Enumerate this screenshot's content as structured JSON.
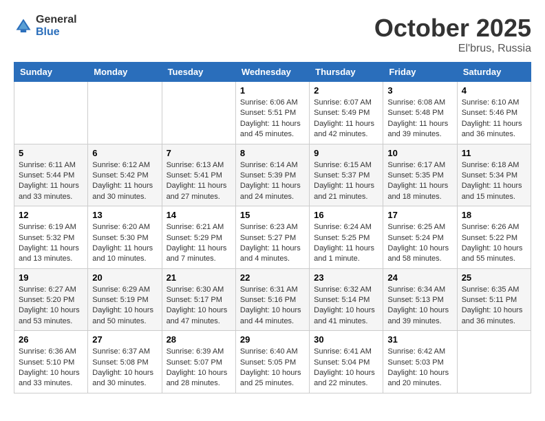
{
  "header": {
    "logo": {
      "general": "General",
      "blue": "Blue",
      "tagline": ""
    },
    "title": "October 2025",
    "location": "El'brus, Russia"
  },
  "weekdays": [
    "Sunday",
    "Monday",
    "Tuesday",
    "Wednesday",
    "Thursday",
    "Friday",
    "Saturday"
  ],
  "weeks": [
    [
      {
        "day": "",
        "info": ""
      },
      {
        "day": "",
        "info": ""
      },
      {
        "day": "",
        "info": ""
      },
      {
        "day": "1",
        "info": "Sunrise: 6:06 AM\nSunset: 5:51 PM\nDaylight: 11 hours and 45 minutes."
      },
      {
        "day": "2",
        "info": "Sunrise: 6:07 AM\nSunset: 5:49 PM\nDaylight: 11 hours and 42 minutes."
      },
      {
        "day": "3",
        "info": "Sunrise: 6:08 AM\nSunset: 5:48 PM\nDaylight: 11 hours and 39 minutes."
      },
      {
        "day": "4",
        "info": "Sunrise: 6:10 AM\nSunset: 5:46 PM\nDaylight: 11 hours and 36 minutes."
      }
    ],
    [
      {
        "day": "5",
        "info": "Sunrise: 6:11 AM\nSunset: 5:44 PM\nDaylight: 11 hours and 33 minutes."
      },
      {
        "day": "6",
        "info": "Sunrise: 6:12 AM\nSunset: 5:42 PM\nDaylight: 11 hours and 30 minutes."
      },
      {
        "day": "7",
        "info": "Sunrise: 6:13 AM\nSunset: 5:41 PM\nDaylight: 11 hours and 27 minutes."
      },
      {
        "day": "8",
        "info": "Sunrise: 6:14 AM\nSunset: 5:39 PM\nDaylight: 11 hours and 24 minutes."
      },
      {
        "day": "9",
        "info": "Sunrise: 6:15 AM\nSunset: 5:37 PM\nDaylight: 11 hours and 21 minutes."
      },
      {
        "day": "10",
        "info": "Sunrise: 6:17 AM\nSunset: 5:35 PM\nDaylight: 11 hours and 18 minutes."
      },
      {
        "day": "11",
        "info": "Sunrise: 6:18 AM\nSunset: 5:34 PM\nDaylight: 11 hours and 15 minutes."
      }
    ],
    [
      {
        "day": "12",
        "info": "Sunrise: 6:19 AM\nSunset: 5:32 PM\nDaylight: 11 hours and 13 minutes."
      },
      {
        "day": "13",
        "info": "Sunrise: 6:20 AM\nSunset: 5:30 PM\nDaylight: 11 hours and 10 minutes."
      },
      {
        "day": "14",
        "info": "Sunrise: 6:21 AM\nSunset: 5:29 PM\nDaylight: 11 hours and 7 minutes."
      },
      {
        "day": "15",
        "info": "Sunrise: 6:23 AM\nSunset: 5:27 PM\nDaylight: 11 hours and 4 minutes."
      },
      {
        "day": "16",
        "info": "Sunrise: 6:24 AM\nSunset: 5:25 PM\nDaylight: 11 hours and 1 minute."
      },
      {
        "day": "17",
        "info": "Sunrise: 6:25 AM\nSunset: 5:24 PM\nDaylight: 10 hours and 58 minutes."
      },
      {
        "day": "18",
        "info": "Sunrise: 6:26 AM\nSunset: 5:22 PM\nDaylight: 10 hours and 55 minutes."
      }
    ],
    [
      {
        "day": "19",
        "info": "Sunrise: 6:27 AM\nSunset: 5:20 PM\nDaylight: 10 hours and 53 minutes."
      },
      {
        "day": "20",
        "info": "Sunrise: 6:29 AM\nSunset: 5:19 PM\nDaylight: 10 hours and 50 minutes."
      },
      {
        "day": "21",
        "info": "Sunrise: 6:30 AM\nSunset: 5:17 PM\nDaylight: 10 hours and 47 minutes."
      },
      {
        "day": "22",
        "info": "Sunrise: 6:31 AM\nSunset: 5:16 PM\nDaylight: 10 hours and 44 minutes."
      },
      {
        "day": "23",
        "info": "Sunrise: 6:32 AM\nSunset: 5:14 PM\nDaylight: 10 hours and 41 minutes."
      },
      {
        "day": "24",
        "info": "Sunrise: 6:34 AM\nSunset: 5:13 PM\nDaylight: 10 hours and 39 minutes."
      },
      {
        "day": "25",
        "info": "Sunrise: 6:35 AM\nSunset: 5:11 PM\nDaylight: 10 hours and 36 minutes."
      }
    ],
    [
      {
        "day": "26",
        "info": "Sunrise: 6:36 AM\nSunset: 5:10 PM\nDaylight: 10 hours and 33 minutes."
      },
      {
        "day": "27",
        "info": "Sunrise: 6:37 AM\nSunset: 5:08 PM\nDaylight: 10 hours and 30 minutes."
      },
      {
        "day": "28",
        "info": "Sunrise: 6:39 AM\nSunset: 5:07 PM\nDaylight: 10 hours and 28 minutes."
      },
      {
        "day": "29",
        "info": "Sunrise: 6:40 AM\nSunset: 5:05 PM\nDaylight: 10 hours and 25 minutes."
      },
      {
        "day": "30",
        "info": "Sunrise: 6:41 AM\nSunset: 5:04 PM\nDaylight: 10 hours and 22 minutes."
      },
      {
        "day": "31",
        "info": "Sunrise: 6:42 AM\nSunset: 5:03 PM\nDaylight: 10 hours and 20 minutes."
      },
      {
        "day": "",
        "info": ""
      }
    ]
  ]
}
